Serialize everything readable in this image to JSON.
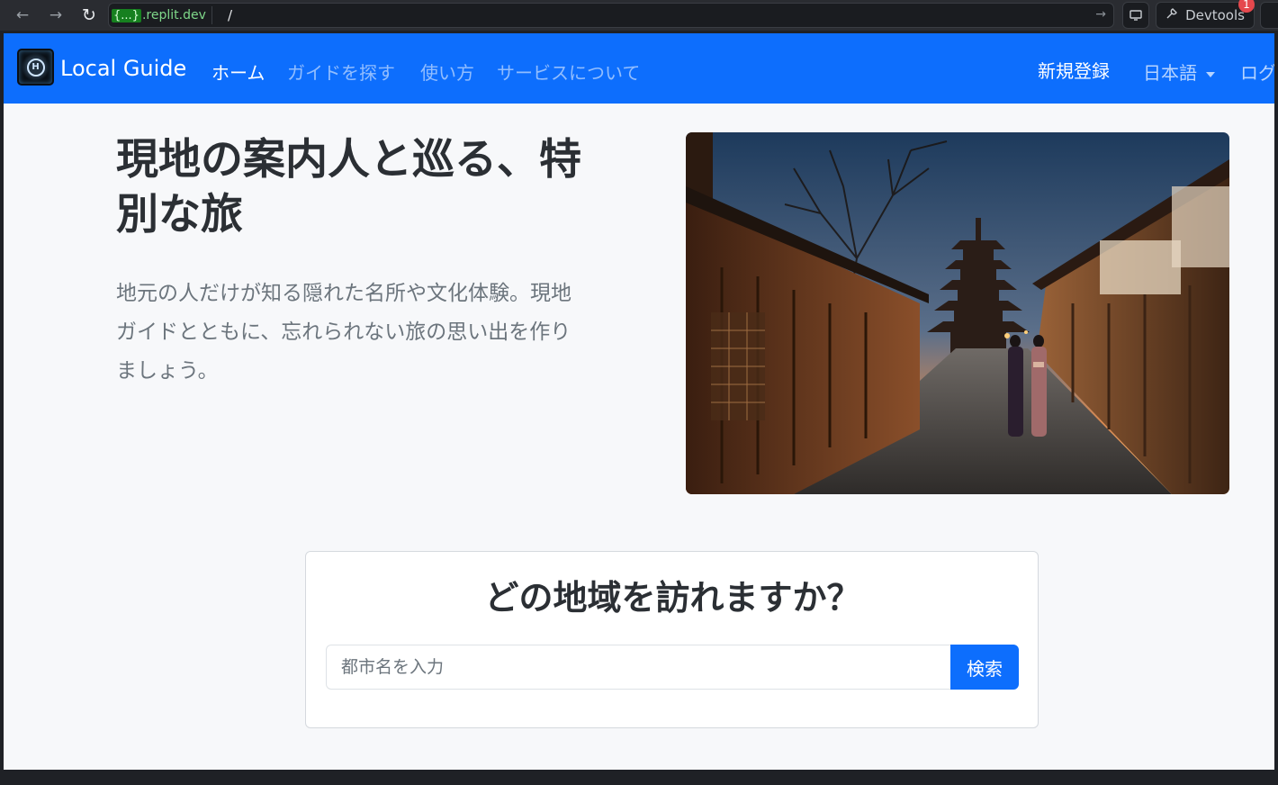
{
  "browser": {
    "url_host_badge": "{...}",
    "url_host": ".replit.dev",
    "url_path": "/",
    "devtools_label": "Devtools",
    "devtools_count": "1"
  },
  "navbar": {
    "brand": "Local Guide",
    "links": [
      {
        "label": "ホーム",
        "active": true
      },
      {
        "label": "ガイドを探す",
        "active": false
      },
      {
        "label": "使い方",
        "active": false
      },
      {
        "label": "サービスについて",
        "active": false
      }
    ],
    "signup": "新規登録",
    "language": "日本語",
    "login_partial": "ログ"
  },
  "hero": {
    "title_line1": "現地の案内人と巡る、特",
    "title_line2": "別な旅",
    "lead_line1": "地元の人だけが知る隠れた名所や文化体験。現地",
    "lead_line2": "ガイドとともに、忘れられない旅の思い出を作り",
    "lead_line3": "ましょう。"
  },
  "search": {
    "heading": "どの地域を訪れますか？",
    "placeholder": "都市名を入力",
    "button": "検索"
  },
  "colors": {
    "brand_blue": "#0d6efd",
    "page_bg": "#f7f8fa"
  }
}
